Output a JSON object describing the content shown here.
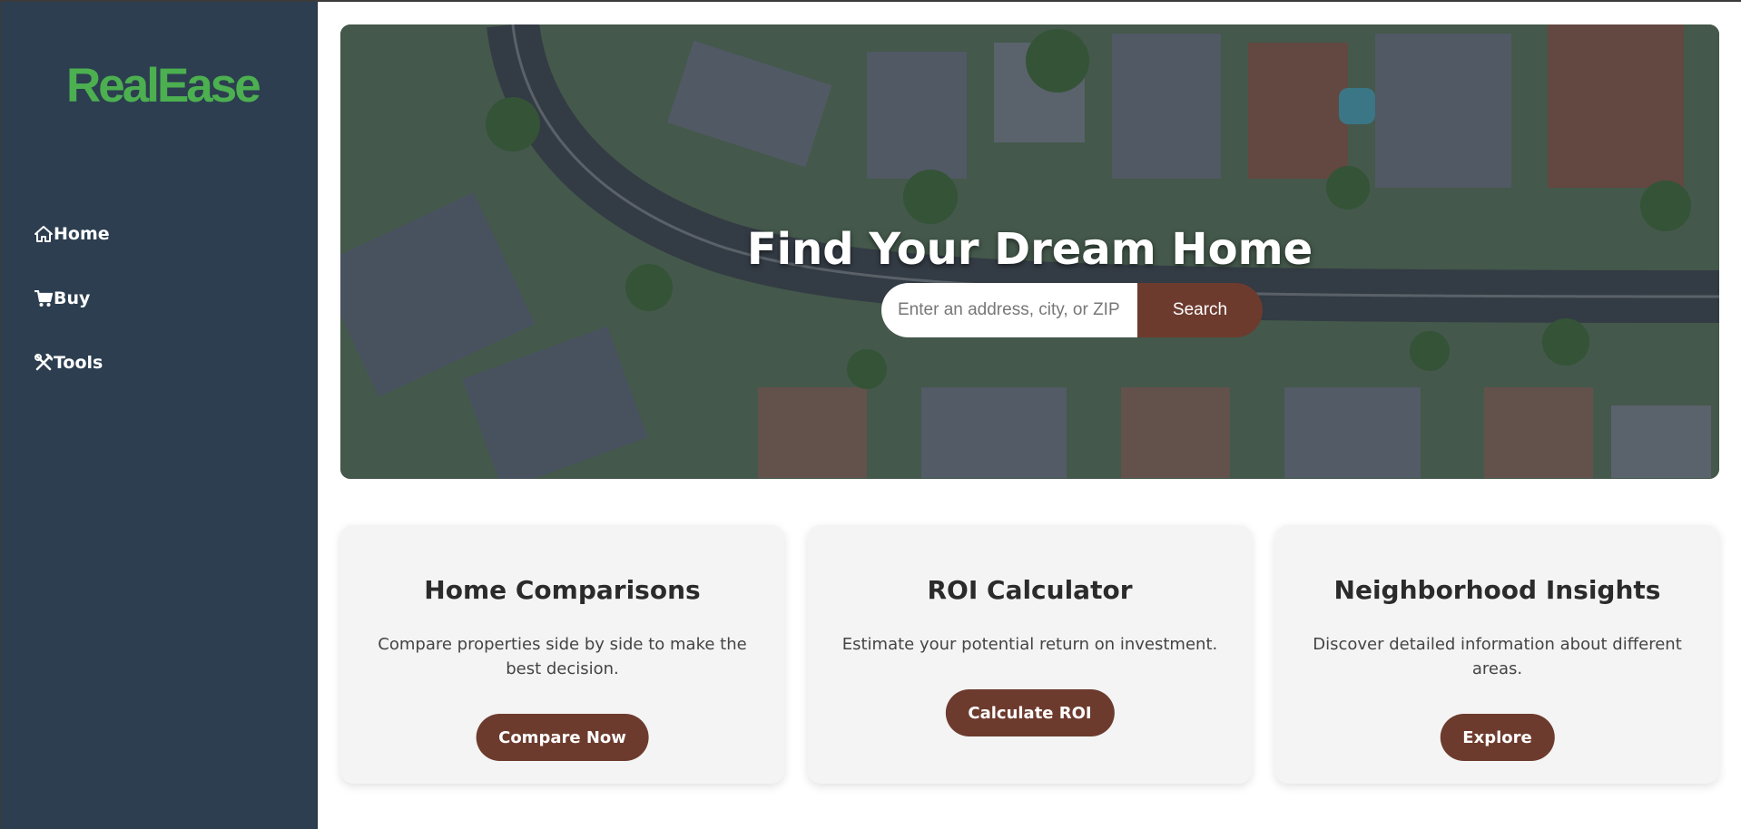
{
  "brand": {
    "name": "RealEase",
    "color": "#4caf50"
  },
  "sidebar": {
    "background": "#2c3e50",
    "items": [
      {
        "icon": "home-icon",
        "label": "Home"
      },
      {
        "icon": "cart-icon",
        "label": "Buy"
      },
      {
        "icon": "tools-icon",
        "label": "Tools"
      }
    ]
  },
  "hero": {
    "title": "Find Your Dream Home",
    "background": "aerial-neighborhood-photo",
    "search": {
      "placeholder": "Enter an address, city, or ZIP code",
      "button_label": "Search"
    }
  },
  "cards": [
    {
      "title": "Home Comparisons",
      "description": "Compare properties side by side to make the best decision.",
      "button_label": "Compare Now"
    },
    {
      "title": "ROI Calculator",
      "description": "Estimate your potential return on investment.",
      "button_label": "Calculate ROI"
    },
    {
      "title": "Neighborhood Insights",
      "description": "Discover detailed information about different areas.",
      "button_label": "Explore"
    }
  ],
  "colors": {
    "accent_button": "#6d3b2e",
    "card_background": "#f4f4f4",
    "text_dark": "#2b2b2b"
  }
}
